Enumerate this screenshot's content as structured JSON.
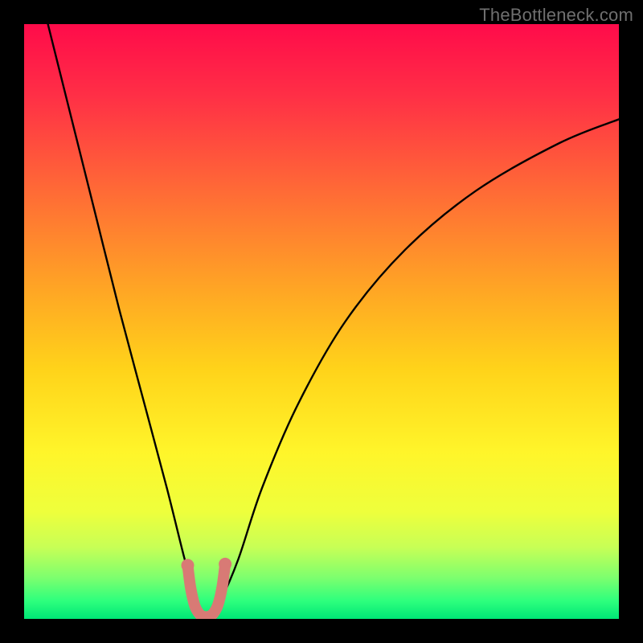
{
  "watermark": "TheBottleneck.com",
  "chart_data": {
    "type": "line",
    "title": "",
    "xlabel": "",
    "ylabel": "",
    "xlim": [
      0,
      100
    ],
    "ylim": [
      0,
      100
    ],
    "grid": false,
    "legend": false,
    "series": [
      {
        "name": "bottleneck-curve",
        "color": "#000000",
        "x": [
          4,
          8,
          12,
          16,
          20,
          24,
          27,
          29,
          30,
          31,
          33,
          36,
          40,
          46,
          54,
          64,
          76,
          90,
          100
        ],
        "y": [
          100,
          84,
          68,
          52,
          37,
          22,
          10,
          3,
          0,
          0,
          3,
          10,
          22,
          36,
          50,
          62,
          72,
          80,
          84
        ]
      },
      {
        "name": "highlight-segment",
        "color": "#d87a75",
        "x": [
          27.5,
          28.0,
          28.7,
          29.5,
          30.2,
          31.0,
          31.8,
          32.6,
          33.3,
          33.8
        ],
        "y": [
          9.0,
          5.2,
          2.2,
          0.8,
          0.4,
          0.4,
          0.9,
          2.4,
          5.4,
          9.2
        ]
      }
    ],
    "gradient_stops": [
      {
        "pos": 0,
        "color": "#ff0b4a"
      },
      {
        "pos": 12,
        "color": "#ff2f46"
      },
      {
        "pos": 28,
        "color": "#ff6a36"
      },
      {
        "pos": 45,
        "color": "#ffa724"
      },
      {
        "pos": 58,
        "color": "#ffd31a"
      },
      {
        "pos": 72,
        "color": "#fff52a"
      },
      {
        "pos": 82,
        "color": "#eeff3c"
      },
      {
        "pos": 88,
        "color": "#c7ff56"
      },
      {
        "pos": 93,
        "color": "#7eff6e"
      },
      {
        "pos": 97,
        "color": "#2dff7d"
      },
      {
        "pos": 100,
        "color": "#00e676"
      }
    ]
  }
}
